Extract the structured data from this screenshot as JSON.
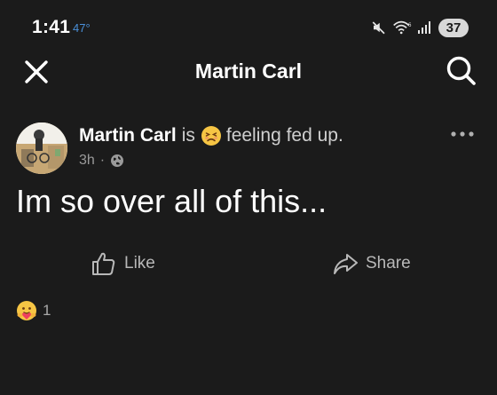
{
  "status_bar": {
    "time": "1:41",
    "temperature": "47°",
    "battery_level": "37",
    "icons": [
      "mute-icon",
      "wifi-icon",
      "signal-icon",
      "battery-icon"
    ],
    "colors": {
      "temperature": "#4a90d9"
    }
  },
  "header": {
    "title": "Martin Carl",
    "close_icon": "close-icon",
    "search_icon": "search-icon"
  },
  "post": {
    "author": "Martin Carl",
    "feeling_prefix": "is",
    "feeling_emoji": "fed-up-face-icon",
    "feeling_text": "feeling fed up.",
    "time_ago": "3h",
    "meta_separator": "·",
    "privacy_icon": "globe-icon",
    "more_icon": "more-dots-icon",
    "text": "Im so over all of this..."
  },
  "actions": {
    "like_label": "Like",
    "share_label": "Share"
  },
  "reactions": {
    "icon": "care-reaction-icon",
    "count": "1"
  }
}
